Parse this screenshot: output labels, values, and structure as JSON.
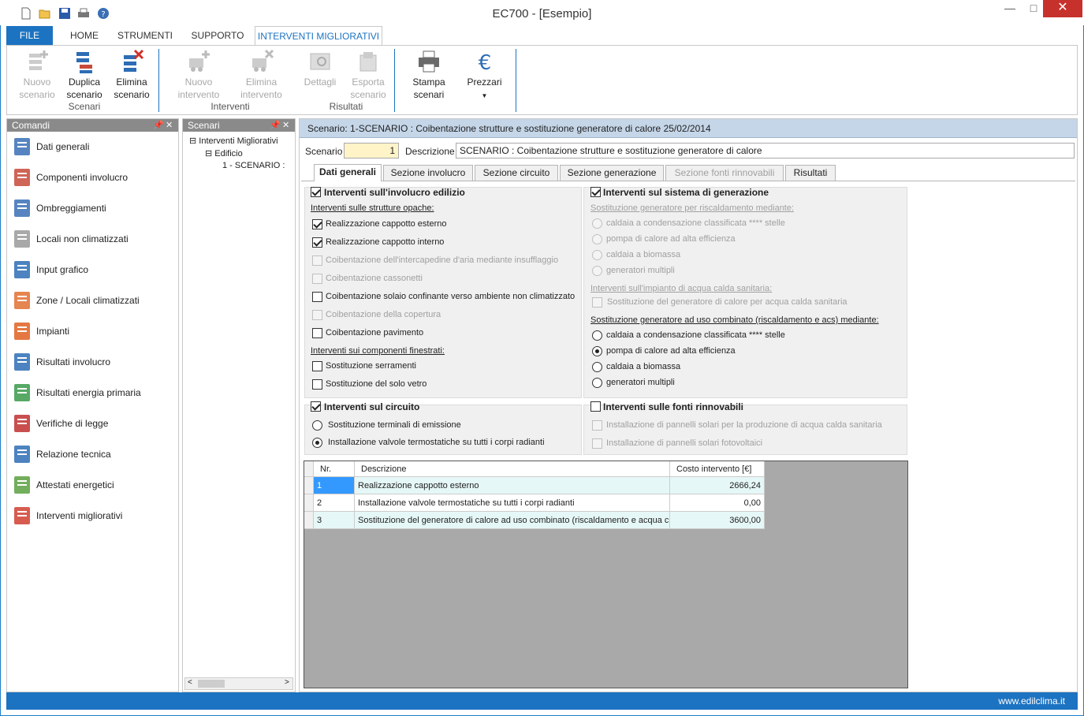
{
  "window": {
    "title": "EC700 - [Esempio]",
    "close": "✕",
    "minimize": "—",
    "maximize": "□"
  },
  "ribbon_tabs": [
    {
      "label": "FILE"
    },
    {
      "label": "HOME"
    },
    {
      "label": "STRUMENTI"
    },
    {
      "label": "SUPPORTO"
    },
    {
      "label": "INTERVENTI MIGLIORATIVI"
    }
  ],
  "ribbon": {
    "scenari_group": "Scenari",
    "interventi_group": "Interventi",
    "risultati_group": "Risultati",
    "nuovo_scenario": [
      "Nuovo",
      "scenario"
    ],
    "duplica_scenario": [
      "Duplica",
      "scenario"
    ],
    "elimina_scenario": [
      "Elimina",
      "scenario"
    ],
    "nuovo_intervento": [
      "Nuovo",
      "intervento"
    ],
    "elimina_intervento": [
      "Elimina",
      "intervento"
    ],
    "dettagli": "Dettagli",
    "esporta_scenario": [
      "Esporta",
      "scenario"
    ],
    "stampa_scenari": [
      "Stampa",
      "scenari"
    ],
    "prezzari": "Prezzari"
  },
  "commands": {
    "title": "Comandi",
    "items": [
      {
        "label": "Dati generali",
        "icon": "document-icon"
      },
      {
        "label": "Componenti involucro",
        "icon": "bricks-icon"
      },
      {
        "label": "Ombreggiamenti",
        "icon": "shading-icon"
      },
      {
        "label": "Locali non climatizzati",
        "icon": "house-gray-icon"
      },
      {
        "label": "Input grafico",
        "icon": "drawing-icon"
      },
      {
        "label": "Zone / Locali climatizzati",
        "icon": "house-icon"
      },
      {
        "label": "Impianti",
        "icon": "flame-icon"
      },
      {
        "label": "Risultati involucro",
        "icon": "calculator-icon"
      },
      {
        "label": "Risultati energia primaria",
        "icon": "calculator-green-icon"
      },
      {
        "label": "Verifiche di legge",
        "icon": "seal-icon"
      },
      {
        "label": "Relazione tecnica",
        "icon": "report-icon"
      },
      {
        "label": "Attestati energetici",
        "icon": "energy-class-icon"
      },
      {
        "label": "Interventi migliorativi",
        "icon": "house-arrows-icon"
      }
    ]
  },
  "scenari_tree": {
    "title": "Scenari",
    "root": "Interventi Migliorativi",
    "child": "Edificio",
    "leaf": "1 - SCENARIO :"
  },
  "main": {
    "header": "Scenario: 1-SCENARIO : Coibentazione strutture e sostituzione generatore di calore 25/02/2014",
    "scenario_label": "Scenario",
    "scenario_value": "1",
    "descrizione_label": "Descrizione",
    "descrizione_value": "SCENARIO : Coibentazione strutture e sostituzione generatore di calore",
    "tabs": [
      "Dati generali",
      "Sezione involucro",
      "Sezione circuito",
      "Sezione generazione",
      "Sezione fonti rinnovabili",
      "Risultati"
    ],
    "involucro": {
      "title": "Interventi sull'involucro edilizio",
      "opache_title": "Interventi sulle strutture opache:",
      "opache": [
        "Realizzazione cappotto esterno",
        "Realizzazione cappotto interno",
        "Coibentazione dell'intercapedine d'aria mediante insufflaggio",
        "Coibentazione cassonetti",
        "Coibentazione solaio confinante verso ambiente non climatizzato",
        "Coibentazione della copertura",
        "Coibentazione pavimento"
      ],
      "fin_title": "Interventi sui componenti finestrati:",
      "finestrati": [
        "Sostituzione serramenti",
        "Sostituzione del solo vetro"
      ]
    },
    "generazione": {
      "title": "Interventi sul sistema di generazione",
      "risc_title": "Sostituzione generatore per riscaldamento mediante:",
      "risc": [
        "caldaia a condensazione classificata **** stelle",
        "pompa di calore ad alta efficienza",
        "caldaia a biomassa",
        "generatori multipli"
      ],
      "acs_title": "Interventi sull'impianto di acqua calda sanitaria:",
      "acs": [
        "Sostituzione del generatore di calore per acqua calda sanitaria"
      ],
      "comb_title": "Sostituzione generatore ad uso combinato (riscaldamento e acs) mediante:",
      "comb": [
        "caldaia a condensazione classificata **** stelle",
        "pompa di calore ad alta efficienza",
        "caldaia a biomassa",
        "generatori multipli"
      ]
    },
    "circuito": {
      "title": "Interventi sul circuito",
      "items": [
        "Sostituzione terminali di emissione",
        "Installazione valvole termostatiche su tutti i corpi radianti"
      ]
    },
    "rinnovabili": {
      "title": "Interventi sulle fonti rinnovabili",
      "items": [
        "Installazione di pannelli solari per la produzione di acqua calda sanitaria",
        "Installazione di pannelli solari fotovoltaici"
      ]
    },
    "table": {
      "headers": [
        "Nr.",
        "Descrizione",
        "Costo intervento [€]"
      ],
      "rows": [
        [
          "1",
          "Realizzazione cappotto esterno",
          "2666,24"
        ],
        [
          "2",
          "Installazione valvole termostatiche su tutti i corpi radianti",
          "0,00"
        ],
        [
          "3",
          "Sostituzione del generatore di calore ad uso combinato (riscaldamento e acqua c...",
          "3600,00"
        ]
      ]
    }
  },
  "status": {
    "url": "www.edilclima.it"
  },
  "colors": {
    "accent": "#1c73c1",
    "close": "#c7312c",
    "header": "#c5d6e8",
    "selected_row": "#3399ff"
  }
}
